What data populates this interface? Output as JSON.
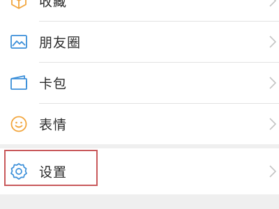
{
  "menu": {
    "items": [
      {
        "label": "收藏",
        "icon": "cube-icon"
      },
      {
        "label": "朋友圈",
        "icon": "image-icon"
      },
      {
        "label": "卡包",
        "icon": "card-wallet-icon"
      },
      {
        "label": "表情",
        "icon": "smiley-icon"
      },
      {
        "label": "设置",
        "icon": "gear-icon",
        "highlighted": true
      }
    ]
  },
  "colors": {
    "icon_blue": "#3b8fd9",
    "icon_orange": "#f2a53c",
    "highlight_border": "#c8585a",
    "page_background": "#efefef",
    "row_background": "#ffffff"
  }
}
